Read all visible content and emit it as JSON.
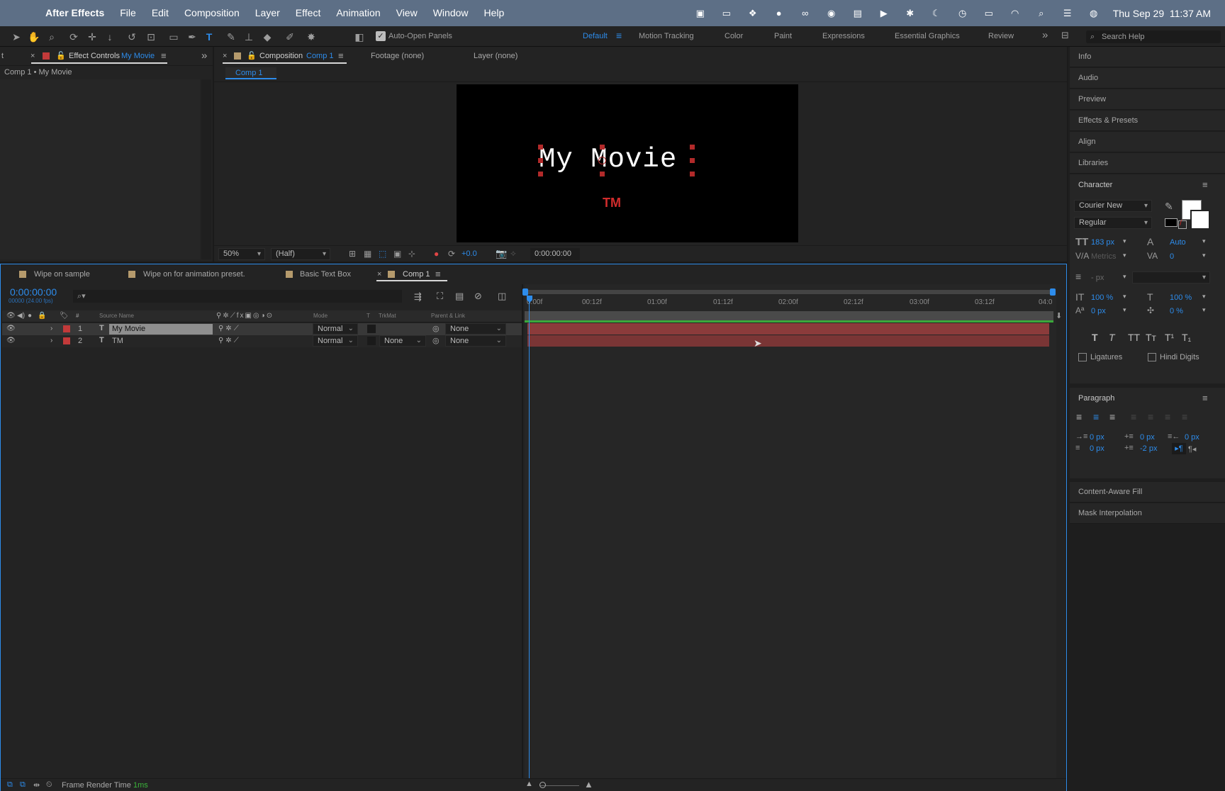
{
  "menubar": {
    "app_name": "After Effects",
    "items": [
      "File",
      "Edit",
      "Composition",
      "Layer",
      "Effect",
      "Animation",
      "View",
      "Window",
      "Help"
    ],
    "datetime": "Thu Sep 29  11:37 AM"
  },
  "toolbar": {
    "auto_open_label": "Auto-Open Panels",
    "workspaces": [
      "Default",
      "Motion Tracking",
      "Color",
      "Paint",
      "Expressions",
      "Essential Graphics",
      "Review"
    ],
    "search_placeholder": "Search Help"
  },
  "left_panel": {
    "tab_label": "Effect Controls",
    "tab_target": "My Movie",
    "breadcrumb": "Comp 1 • My Movie"
  },
  "viewer": {
    "tab_label": "Composition",
    "tab_target": "Comp 1",
    "footage_tab": "Footage (none)",
    "layer_tab": "Layer (none)",
    "subtab": "Comp 1",
    "title_text": "My Movie",
    "tm_text": "TM",
    "zoom": "50%",
    "resolution": "(Half)",
    "exposure": "+0.0",
    "timecode": "0:00:00:00"
  },
  "timeline": {
    "tabs": [
      "Wipe on sample",
      "Wipe on for animation preset.",
      "Basic Text Box",
      "Comp 1"
    ],
    "current_time": "0:00:00:00",
    "frames_fps": "00000 (24.00 fps)",
    "columns": {
      "source_name": "Source Name",
      "mode": "Mode",
      "t": "T",
      "trkmat": "TrkMat",
      "parent": "Parent & Link"
    },
    "ruler": [
      "0:00f",
      "00:12f",
      "01:00f",
      "01:12f",
      "02:00f",
      "02:12f",
      "03:00f",
      "03:12f",
      "04:0"
    ],
    "layers": [
      {
        "num": "1",
        "type": "T",
        "name": "My Movie",
        "mode": "Normal",
        "trkmat": "",
        "parent": "None"
      },
      {
        "num": "2",
        "type": "T",
        "name": "TM",
        "mode": "Normal",
        "trkmat": "None",
        "parent": "None"
      }
    ],
    "footer_label": "Frame Render Time",
    "footer_value": "1ms"
  },
  "right_panel": {
    "items": [
      "Info",
      "Audio",
      "Preview",
      "Effects & Presets",
      "Align",
      "Libraries"
    ],
    "character": {
      "title": "Character",
      "font": "Courier New",
      "style": "Regular",
      "size": "183 px",
      "leading": "Auto",
      "kerning": "Metrics",
      "tracking": "0",
      "stroke": "- px",
      "vscale": "100 %",
      "hscale": "100 %",
      "baseline": "0 px",
      "tsume": "0 %",
      "ligatures": "Ligatures",
      "hindi_digits": "Hindi Digits"
    },
    "paragraph": {
      "title": "Paragraph",
      "indent_left": "0 px",
      "space_before": "0 px",
      "indent_right": "0 px",
      "first_line": "0 px",
      "space_after": "-2 px"
    },
    "bottom_items": [
      "Content-Aware Fill",
      "Mask Interpolation"
    ]
  }
}
